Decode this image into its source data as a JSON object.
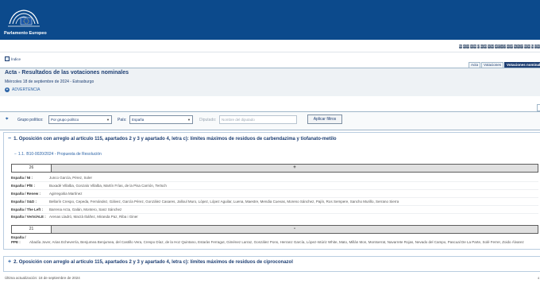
{
  "header": {
    "logo_text": "Parlamento Europeo",
    "brand_color": "#0c4a8c"
  },
  "languages": [
    "BG",
    "ES",
    "CS",
    "DA",
    "DE",
    "ET",
    "EL",
    "EN",
    "FR",
    "GA",
    "HR",
    "IT",
    "LV",
    "LT",
    "HU",
    "MT",
    "NL",
    "PL",
    "PT",
    "RO",
    "SK",
    "SL",
    "FI",
    "SV"
  ],
  "nav": {
    "index_label": "Índice",
    "tabs": [
      {
        "label": "Acta",
        "active": false
      },
      {
        "label": "Votaciones",
        "active": false
      },
      {
        "label": "Votaciones nominales",
        "active": true
      }
    ]
  },
  "page": {
    "title": "Acta - Resultados de las votaciones nominales",
    "subtitle": "Miércoles 18 de septiembre de 2024 - Estrasburgo",
    "warning": "ADVERTENCIA"
  },
  "filters": {
    "group_label": "Grupo político:",
    "group_value": "Por grupo político",
    "country_label": "País:",
    "country_value": "España",
    "deputy_label": "Diputado:",
    "deputy_placeholder": "Nombre del diputado",
    "apply_label": "Aplicar filtros"
  },
  "sections": [
    {
      "toggle": "−",
      "title": "1. Oposición con arreglo al artículo 115, apartados 2 y 3 y apartado 4, letra c): límites máximos de residuos de carbendazima y tiofanato-metilo",
      "subsection": {
        "toggle": "−",
        "number": "1.1.",
        "title": "B10-0020/2024 - Propuesta de Resolución",
        "votes_for": {
          "count": "26",
          "sign": "+",
          "rows": [
            {
              "group": "España / NI :",
              "members": "Junco García, Pérez, Soler"
            },
            {
              "group": "España / PfE :",
              "members": "Buxadé Villalba, Gonzalo Villalba, Martín Frías, de la Pisa Carrión, Tertsch"
            },
            {
              "group": "España / Renew :",
              "members": "Agirregoitia Martínez"
            },
            {
              "group": "España / S&D :",
              "members": "Bellarín Crespo, Cepeda, Fernández, Gálvez, García Pérez, González Casares, Jalloul Muro, López, López Aguilar, Luena, Maestre, Mendia Cuevas, Moreno Sánchez, Pajín, Ros Sempere, Sancho Murillo, Serrano Sierra"
            },
            {
              "group": "España / The Left :",
              "members": "Barrena Arza, Galán, Montero, Sanz Sánchez"
            },
            {
              "group": "España / Verts/ALE :",
              "members": "Arenas Lladró, Marzà Ibáñez, Miranda Paz, Riba i Giner"
            }
          ]
        },
        "votes_against": {
          "count": "21",
          "sign": "-",
          "group": "España / PPE :",
          "members": "Abadía Jover, Arias Echeverría, Benjumea Benjumea, del Castillo Vera, Crespo Díaz, de la Hoz Quintano, Estaràs Ferragut, Giménez Larraz, González Pons, Herranz García, López-Istúriz White, Mato, Millán Mon, Montserrat, Navarrete Rojas, Nevado del Campo, Pascual De La Parte, Solé Ferrer, Zoido Álvarez"
        }
      }
    },
    {
      "toggle": "+",
      "title": "2. Oposición con arreglo al artículo 115, apartados 2 y 3 y apartado 4, letra c): límites máximos de residuos de ciproconazol"
    }
  ],
  "footer": {
    "last_update": "Última actualización: 18 de septiembre de 2024",
    "mark": "4"
  }
}
